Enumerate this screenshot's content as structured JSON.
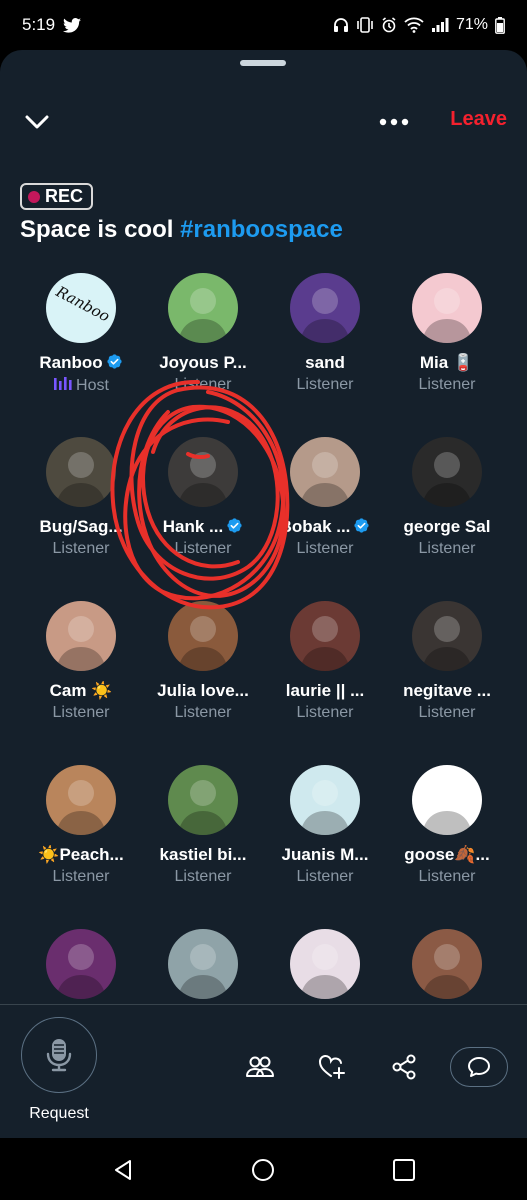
{
  "status_bar": {
    "time": "5:19",
    "battery": "71%",
    "icons": [
      "twitter-icon",
      "headphones-icon",
      "vibrate-icon",
      "alarm-icon",
      "wifi-icon",
      "signal-icon",
      "battery-icon"
    ]
  },
  "topbar": {
    "leave_label": "Leave",
    "icons": [
      "chevron-down-icon",
      "more-icon"
    ]
  },
  "space": {
    "rec_label": "REC",
    "title": "Space is cool ",
    "hashtag": "#ranboospace"
  },
  "participants": [
    {
      "name": "Ranboo",
      "role": "Host",
      "verified": true,
      "avatar_color": "#d9f3f7",
      "avatar_text": "Ranboo"
    },
    {
      "name": "Joyous P...",
      "role": "Listener",
      "verified": false,
      "avatar_color": "#7ab86b"
    },
    {
      "name": "sand",
      "role": "Listener",
      "verified": false,
      "avatar_color": "#5a3c8e"
    },
    {
      "name": "Mia 🪫",
      "role": "Listener",
      "verified": false,
      "avatar_color": "#f4c9d0"
    },
    {
      "name": "Bug/Sag...",
      "role": "Listener",
      "verified": false,
      "avatar_color": "#4e4a3f"
    },
    {
      "name": "Hank ...",
      "role": "Listener",
      "verified": true,
      "avatar_color": "#3d3b3a"
    },
    {
      "name": "Bobak ...",
      "role": "Listener",
      "verified": true,
      "avatar_color": "#b59a8a"
    },
    {
      "name": "george Sal",
      "role": "Listener",
      "verified": false,
      "avatar_color": "#2a2a2a"
    },
    {
      "name": "Cam ☀️",
      "role": "Listener",
      "verified": false,
      "avatar_color": "#c89a85"
    },
    {
      "name": "Julia love...",
      "role": "Listener",
      "verified": false,
      "avatar_color": "#8a5a3c"
    },
    {
      "name": "laurie || ...",
      "role": "Listener",
      "verified": false,
      "avatar_color": "#6b3a34"
    },
    {
      "name": "negitave ...",
      "role": "Listener",
      "verified": false,
      "avatar_color": "#3a3533"
    },
    {
      "name": "☀️Peach...",
      "role": "Listener",
      "verified": false,
      "avatar_color": "#b9855c"
    },
    {
      "name": "kastiel bi...",
      "role": "Listener",
      "verified": false,
      "avatar_color": "#5f8a4e"
    },
    {
      "name": "Juanis M...",
      "role": "Listener",
      "verified": false,
      "avatar_color": "#cfe9ee"
    },
    {
      "name": "goose🍂...",
      "role": "Listener",
      "verified": false,
      "avatar_color": "#ffffff"
    },
    {
      "name": "",
      "role": "",
      "verified": false,
      "avatar_color": "#6a2e6e"
    },
    {
      "name": "",
      "role": "",
      "verified": false,
      "avatar_color": "#8fa3a8"
    },
    {
      "name": "",
      "role": "",
      "verified": false,
      "avatar_color": "#e8dde6"
    },
    {
      "name": "",
      "role": "",
      "verified": false,
      "avatar_color": "#8b5a45"
    }
  ],
  "bottom": {
    "request_label": "Request",
    "icons": [
      "microphone-icon",
      "people-icon",
      "heart-add-icon",
      "share-icon",
      "chat-bubble-icon"
    ]
  },
  "navbar": {
    "icons": [
      "back-icon",
      "home-icon",
      "recents-icon"
    ]
  },
  "colors": {
    "background": "#15202b",
    "accent": "#1d9bf0",
    "leave": "#f4212e",
    "muted": "#8b98a5",
    "host": "#7856ff",
    "annotation": "#e8302a"
  }
}
